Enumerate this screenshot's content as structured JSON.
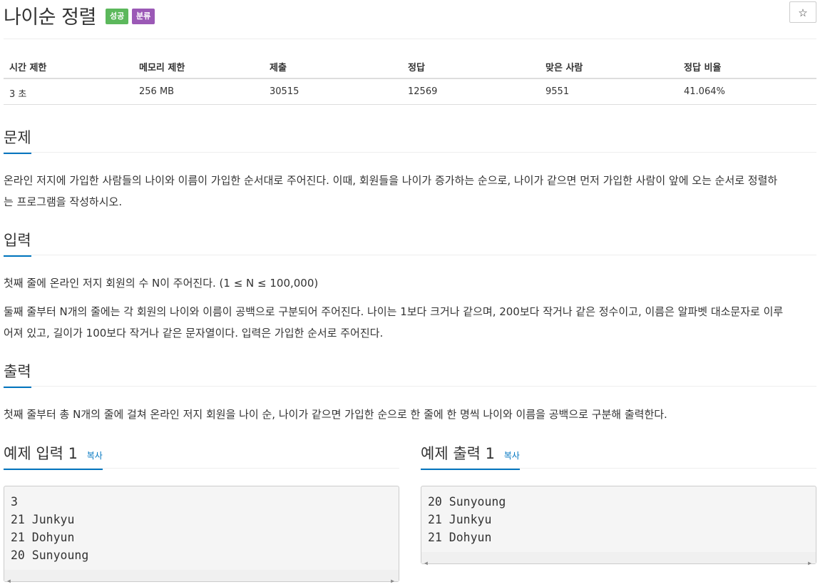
{
  "header": {
    "title": "나이순 정렬",
    "badges": [
      "성공",
      "분류"
    ],
    "star_icon": "☆"
  },
  "stats": {
    "headers": [
      "시간 제한",
      "메모리 제한",
      "제출",
      "정답",
      "맞은 사람",
      "정답 비율"
    ],
    "values": [
      "3 초",
      "256 MB",
      "30515",
      "12569",
      "9551",
      "41.064%"
    ]
  },
  "problem": {
    "heading": "문제",
    "lines": [
      "온라인 저지에 가입한 사람들의 나이와 이름이 가입한 순서대로 주어진다. 이때, 회원들을 나이가 증가하는 순으로, 나이가 같으면 먼저 가입한 사람이 앞에 오는 순서로 정렬하",
      "는 프로그램을 작성하시오."
    ]
  },
  "input": {
    "heading": "입력",
    "p1": "첫째 줄에 온라인 저지 회원의 수 N이 주어진다. (1 ≤ N ≤ 100,000)",
    "p2_lines": [
      "둘째 줄부터 N개의 줄에는 각 회원의 나이와 이름이 공백으로 구분되어 주어진다. 나이는 1보다 크거나 같으며, 200보다 작거나 같은 정수이고, 이름은 알파벳 대소문자로 이루",
      "어져 있고, 길이가 100보다 작거나 같은 문자열이다. 입력은 가입한 순서로 주어진다."
    ]
  },
  "output": {
    "heading": "출력",
    "text": "첫째 줄부터 총 N개의 줄에 걸쳐 온라인 저지 회원을 나이 순, 나이가 같으면 가입한 순으로 한 줄에 한 명씩 나이와 이름을 공백으로 구분해 출력한다."
  },
  "examples": {
    "input_title": "예제 입력 1",
    "output_title": "예제 출력 1",
    "copy_label": "복사",
    "input_text": "3\n21 Junkyu\n21 Dohyun\n20 Sunyoung",
    "output_text": "20 Sunyoung\n21 Junkyu\n21 Dohyun"
  },
  "colors": {
    "accent": "#0076c0",
    "success_badge": "#5cb85c",
    "category_badge": "#9b59b6"
  }
}
